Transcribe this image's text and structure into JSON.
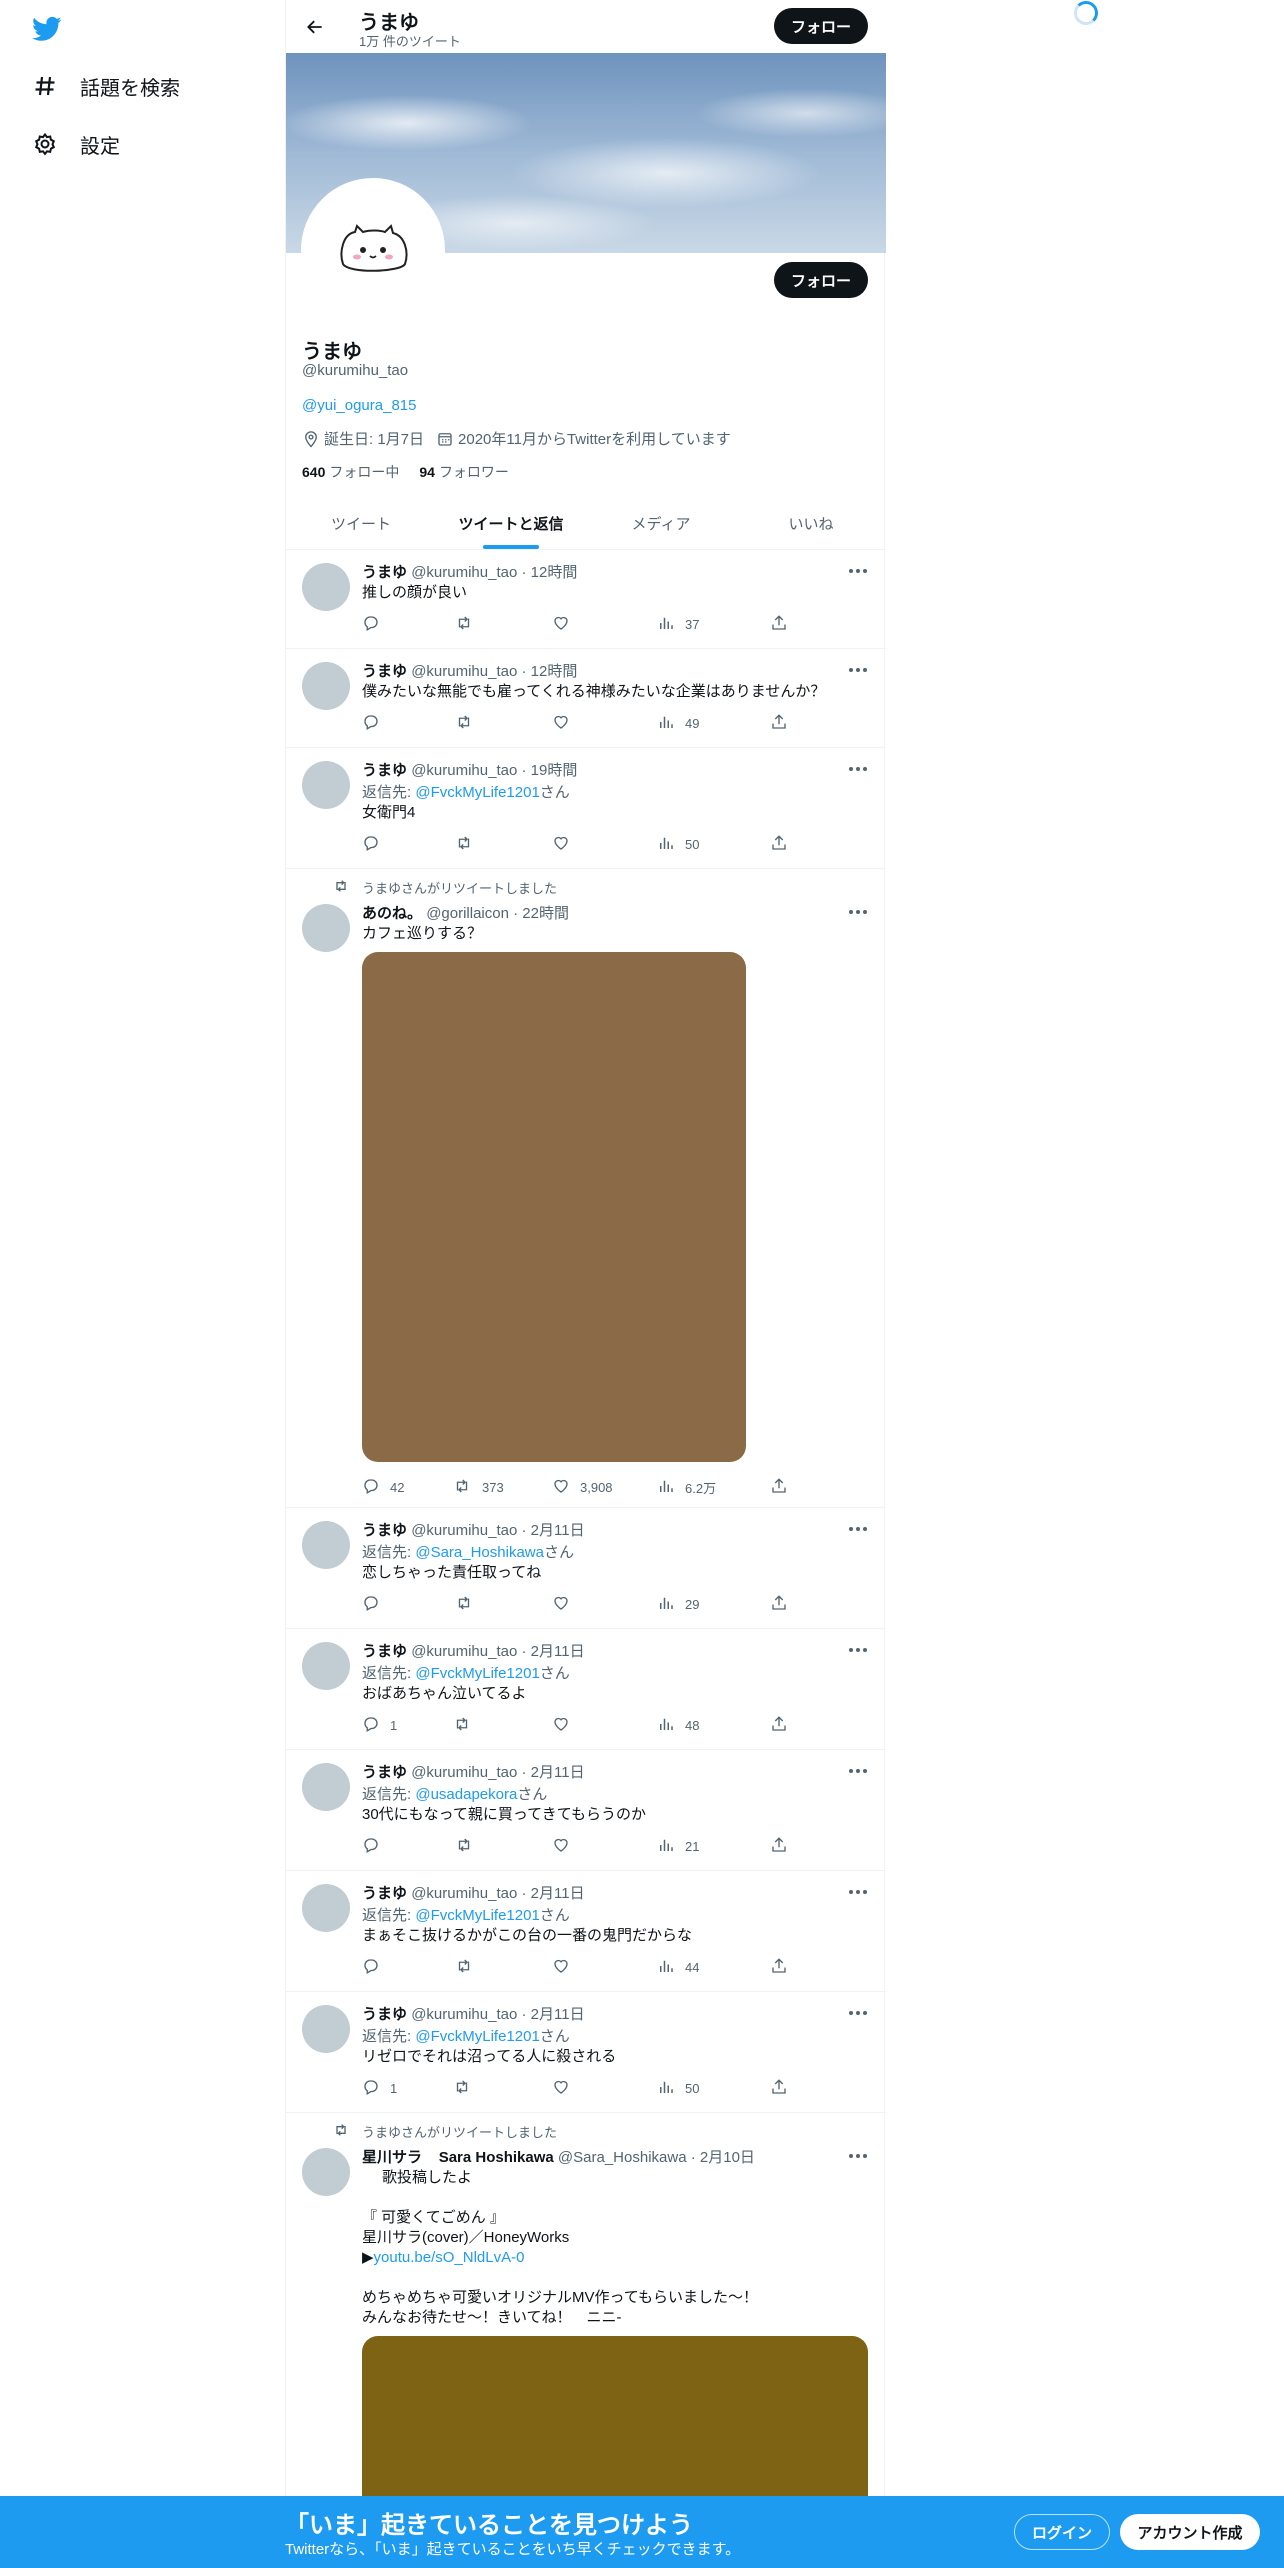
{
  "nav": {
    "explore_label": "話題を検索",
    "settings_label": "設定"
  },
  "profile": {
    "display_name": "うまゆ",
    "tweet_count": "1万 件のツイート",
    "follow_label": "フォロー",
    "handle": "@kurumihu_tao",
    "link": "@yui_ogura_815",
    "birthday": "誕生日: 1月7日",
    "joined": "2020年11月からTwitterを利用しています",
    "following_count": "640",
    "following_label": "フォロー中",
    "followers_count": "94",
    "followers_label": "フォロワー"
  },
  "tabs": [
    "ツイート",
    "ツイートと返信",
    "メディア",
    "いいね"
  ],
  "active_tab": "ツイートと返信",
  "tweets": [
    {
      "name": "うまゆ",
      "handle": "@kurumihu_tao",
      "time": "12時間",
      "reply_to": "",
      "text": "推しの顔が良い",
      "replies": "",
      "retweets": "",
      "likes": "",
      "views": "37"
    },
    {
      "name": "うまゆ",
      "handle": "@kurumihu_tao",
      "time": "12時間",
      "reply_to": "",
      "text": "僕みたいな無能でも雇ってくれる神様みたいな企業はありませんか？",
      "replies": "",
      "retweets": "",
      "likes": "",
      "views": "49"
    },
    {
      "name": "うまゆ",
      "handle": "@kurumihu_tao",
      "time": "19時間",
      "reply_to": "@FvckMyLife1201",
      "text": "女衛門4",
      "replies": "",
      "retweets": "",
      "likes": "",
      "views": "50"
    },
    {
      "retweeted_by": "うまゆさんがリツイートしました",
      "name": "あのね。",
      "handle": "@gorillaicon",
      "time": "22時間",
      "reply_to": "",
      "text": "カフェ巡りする？",
      "replies": "42",
      "retweets": "373",
      "likes": "3,908",
      "views": "6.2万",
      "media_color": "#8b6b47"
    },
    {
      "name": "うまゆ",
      "handle": "@kurumihu_tao",
      "time": "2月11日",
      "reply_to": "@Sara_Hoshikawa",
      "text": "恋しちゃった責任取ってね",
      "replies": "",
      "retweets": "",
      "likes": "",
      "views": "29"
    },
    {
      "name": "うまゆ",
      "handle": "@kurumihu_tao",
      "time": "2月11日",
      "reply_to": "@FvckMyLife1201",
      "text": "おばあちゃん泣いてるよ",
      "replies": "1",
      "retweets": "",
      "likes": "",
      "views": "48"
    },
    {
      "name": "うまゆ",
      "handle": "@kurumihu_tao",
      "time": "2月11日",
      "reply_to": "@usadapekora",
      "text": "30代にもなって親に買ってきてもらうのか",
      "replies": "",
      "retweets": "",
      "likes": "",
      "views": "21"
    },
    {
      "name": "うまゆ",
      "handle": "@kurumihu_tao",
      "time": "2月11日",
      "reply_to": "@FvckMyLife1201",
      "text": "まぁそこ抜けるかがこの台の一番の鬼門だからな",
      "replies": "",
      "retweets": "",
      "likes": "",
      "views": "44"
    },
    {
      "name": "うまゆ",
      "handle": "@kurumihu_tao",
      "time": "2月11日",
      "reply_to": "@FvckMyLife1201",
      "text": "リゼロでそれは沼ってる人に殺される",
      "replies": "1",
      "retweets": "",
      "likes": "",
      "views": "50"
    },
    {
      "retweeted_by": "うまゆさんがリツイートしました",
      "name": "星川サラ",
      "name_suffix": "Sara Hoshikawa",
      "handle": "@Sara_Hoshikawa",
      "time": "2月10日",
      "reply_to": "",
      "text_lines": [
        "歌投稿したよ",
        "",
        "『 可愛くてごめん 』",
        "星川サラ(cover)／HoneyWorks",
        "▶"
      ],
      "link": "youtu.be/sO_NldLvA-0",
      "text_lines_2": [
        "めちゃめちゃ可愛いオリジナルMV作ってもらいました～！",
        "みんなお待たせ～！きいてね！　ニニ-"
      ],
      "media_color": "#7e6314"
    }
  ],
  "reply_prefix": "返信先: ",
  "reply_suffix": "さん",
  "bottom": {
    "title": "「いま」起きていることを見つけよう",
    "subtitle": "Twitterなら、「いま」起きていることをいち早くチェックできます。",
    "login": "ログイン",
    "signup": "アカウント作成"
  },
  "colors": {
    "accent": "#1d9bf0",
    "dark_button": "#0f1419",
    "secondary_text": "#536471"
  }
}
